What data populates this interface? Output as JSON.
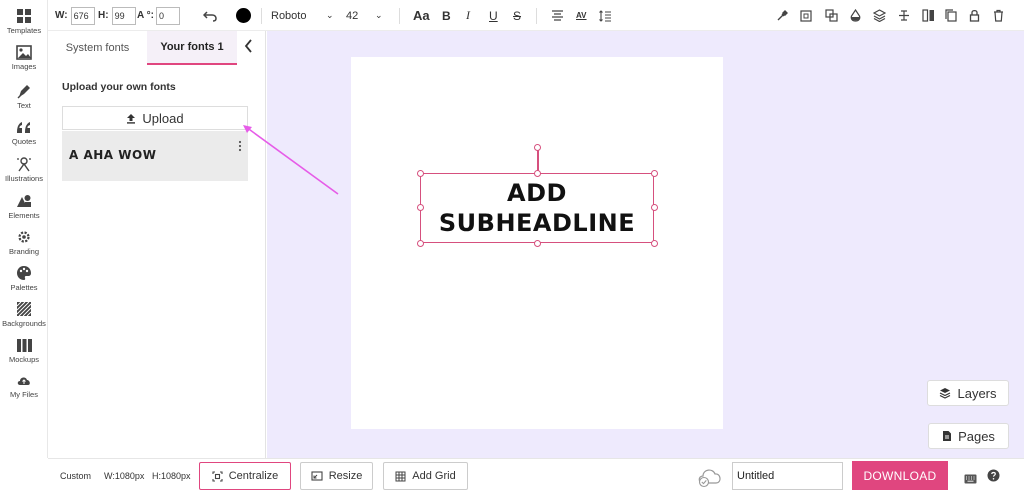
{
  "rail": [
    {
      "label": "Templates",
      "icon": "templates-icon"
    },
    {
      "label": "Images",
      "icon": "images-icon"
    },
    {
      "label": "Text",
      "icon": "text-pen-icon"
    },
    {
      "label": "Quotes",
      "icon": "quotes-icon"
    },
    {
      "label": "Illustrations",
      "icon": "illustrations-icon"
    },
    {
      "label": "Elements",
      "icon": "elements-icon"
    },
    {
      "label": "Branding",
      "icon": "branding-gear-icon"
    },
    {
      "label": "Palettes",
      "icon": "palette-icon"
    },
    {
      "label": "Backgrounds",
      "icon": "backgrounds-icon"
    },
    {
      "label": "Mockups",
      "icon": "mockups-icon"
    },
    {
      "label": "My Files",
      "icon": "cloud-files-icon"
    }
  ],
  "toolbar": {
    "width_label": "W:",
    "width_value": "676",
    "height_label": "H:",
    "height_value": "99",
    "angle_label": "A °:",
    "angle_value": "0",
    "text_color": "#000000",
    "font_family": "Roboto",
    "font_size": "42",
    "case_label": "Aa",
    "bold_label": "B",
    "italic_label": "I",
    "underline_label": "U",
    "strike_label": "S",
    "spacing_label": "AV"
  },
  "panel": {
    "tab_system": "System fonts",
    "tab_yours": "Your fonts 1",
    "heading": "Upload your own fonts",
    "upload_label": "Upload",
    "fonts": [
      {
        "name": "A AHA WOW"
      }
    ]
  },
  "canvas": {
    "text_line1": "ADD",
    "text_line2": "SUBHEADLINE",
    "selection_color": "#d6507e",
    "background": "#eeeafd"
  },
  "floating": {
    "layers_label": "Layers",
    "pages_label": "Pages"
  },
  "bottom": {
    "size_preset": "Custom",
    "width_text": "W:1080px",
    "height_text": "H:1080px",
    "centralize_label": "Centralize",
    "resize_label": "Resize",
    "grid_label": "Add Grid",
    "title_value": "Untitled",
    "download_label": "DOWNLOAD",
    "accent": "#e0467f"
  }
}
